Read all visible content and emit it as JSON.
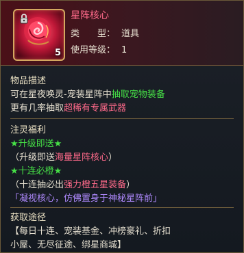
{
  "item": {
    "name": "星阵核心",
    "type_label": "类　　型：",
    "type_value": "道具",
    "level_label": "使用等级：",
    "level_value": "1",
    "count": "5"
  },
  "description": {
    "title": "物品描述",
    "line1_prefix": "可在星夜唤灵-宠装星阵中",
    "line1_highlight": "抽取宠物装备",
    "line2_prefix": "更有几率抽取",
    "line2_highlight": "超稀有专属武器"
  },
  "bonus": {
    "title": "注灵福利",
    "line1": "★升级即送★",
    "line2_prefix": "（升级即送",
    "line2_highlight": "海量星阵核心",
    "line2_suffix": "）",
    "line3": "★十连必橙★",
    "line4_prefix": "（十连抽必出",
    "line4_highlight": "强力橙五星装备",
    "line4_suffix": "）",
    "line5": "「凝视核心，仿佛置身于神秘星阵前」"
  },
  "source": {
    "title": "获取途径",
    "line1": "【每日十连、宠装基金、冲榜豪礼、折扣",
    "line2": "小屋、无尽征途、绑星商城】"
  },
  "colors": {
    "name": "#ff6a8a",
    "highlight_green": "#46e046",
    "highlight_pink": "#ff6a8a",
    "quote_purple": "#b08aff"
  },
  "icons": {
    "item": "rose-core-icon",
    "lock": "lock-icon"
  }
}
